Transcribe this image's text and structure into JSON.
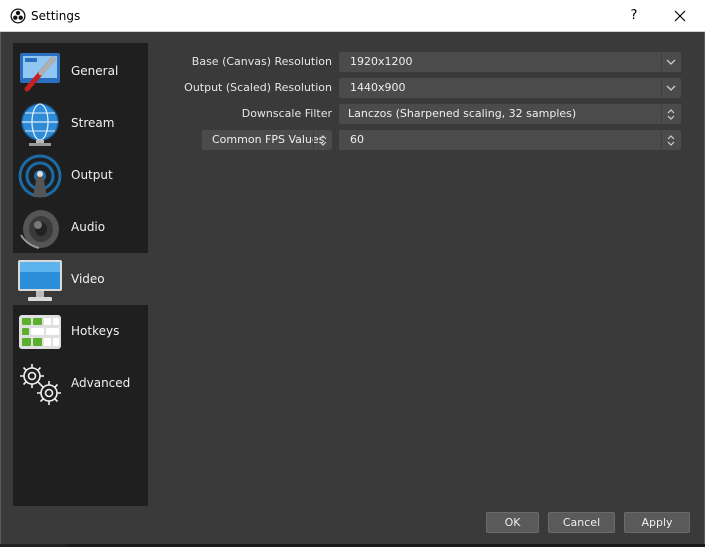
{
  "window": {
    "title": "Settings",
    "help_label": "?",
    "close_icon": "close-icon"
  },
  "sidebar": {
    "items": [
      {
        "label": "General",
        "icon": "general-icon"
      },
      {
        "label": "Stream",
        "icon": "globe-icon"
      },
      {
        "label": "Output",
        "icon": "antenna-icon"
      },
      {
        "label": "Audio",
        "icon": "speaker-icon"
      },
      {
        "label": "Video",
        "icon": "monitor-icon",
        "selected": true
      },
      {
        "label": "Hotkeys",
        "icon": "keyboard-icon"
      },
      {
        "label": "Advanced",
        "icon": "gears-icon"
      }
    ]
  },
  "video": {
    "base_resolution": {
      "label": "Base (Canvas) Resolution",
      "value": "1920x1200"
    },
    "output_resolution": {
      "label": "Output (Scaled) Resolution",
      "value": "1440x900"
    },
    "downscale_filter": {
      "label": "Downscale Filter",
      "value": "Lanczos (Sharpened scaling, 32 samples)"
    },
    "fps": {
      "type_value": "Common FPS Values",
      "value": "60"
    }
  },
  "buttons": {
    "ok": "OK",
    "cancel": "Cancel",
    "apply": "Apply"
  },
  "colors": {
    "background": "#3a3a3a",
    "sidebar": "#1f1f1f",
    "field": "#4b4b4b",
    "button": "#5a5a5a"
  }
}
